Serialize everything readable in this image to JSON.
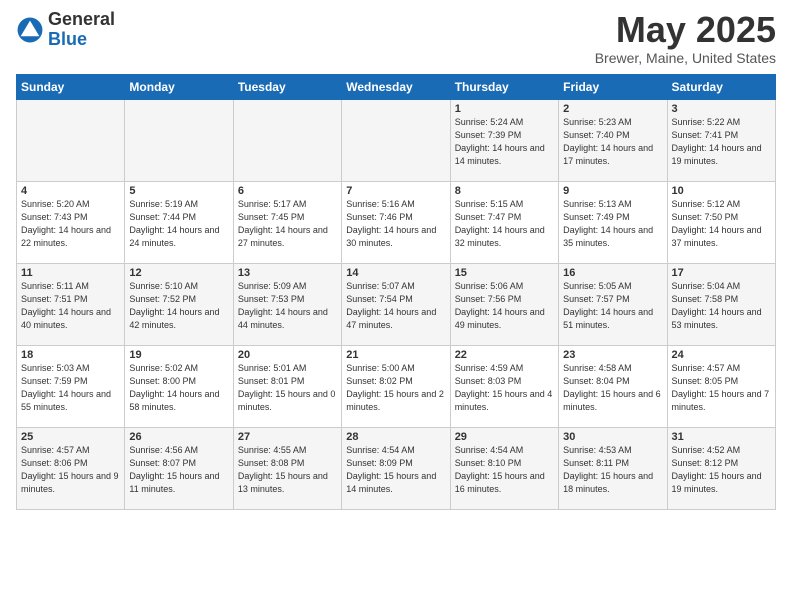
{
  "header": {
    "logo_general": "General",
    "logo_blue": "Blue",
    "title": "May 2025",
    "subtitle": "Brewer, Maine, United States"
  },
  "weekdays": [
    "Sunday",
    "Monday",
    "Tuesday",
    "Wednesday",
    "Thursday",
    "Friday",
    "Saturday"
  ],
  "weeks": [
    [
      {
        "day": null,
        "sunrise": null,
        "sunset": null,
        "daylight": null
      },
      {
        "day": null,
        "sunrise": null,
        "sunset": null,
        "daylight": null
      },
      {
        "day": null,
        "sunrise": null,
        "sunset": null,
        "daylight": null
      },
      {
        "day": null,
        "sunrise": null,
        "sunset": null,
        "daylight": null
      },
      {
        "day": "1",
        "sunrise": "5:24 AM",
        "sunset": "7:39 PM",
        "daylight": "14 hours and 14 minutes."
      },
      {
        "day": "2",
        "sunrise": "5:23 AM",
        "sunset": "7:40 PM",
        "daylight": "14 hours and 17 minutes."
      },
      {
        "day": "3",
        "sunrise": "5:22 AM",
        "sunset": "7:41 PM",
        "daylight": "14 hours and 19 minutes."
      }
    ],
    [
      {
        "day": "4",
        "sunrise": "5:20 AM",
        "sunset": "7:43 PM",
        "daylight": "14 hours and 22 minutes."
      },
      {
        "day": "5",
        "sunrise": "5:19 AM",
        "sunset": "7:44 PM",
        "daylight": "14 hours and 24 minutes."
      },
      {
        "day": "6",
        "sunrise": "5:17 AM",
        "sunset": "7:45 PM",
        "daylight": "14 hours and 27 minutes."
      },
      {
        "day": "7",
        "sunrise": "5:16 AM",
        "sunset": "7:46 PM",
        "daylight": "14 hours and 30 minutes."
      },
      {
        "day": "8",
        "sunrise": "5:15 AM",
        "sunset": "7:47 PM",
        "daylight": "14 hours and 32 minutes."
      },
      {
        "day": "9",
        "sunrise": "5:13 AM",
        "sunset": "7:49 PM",
        "daylight": "14 hours and 35 minutes."
      },
      {
        "day": "10",
        "sunrise": "5:12 AM",
        "sunset": "7:50 PM",
        "daylight": "14 hours and 37 minutes."
      }
    ],
    [
      {
        "day": "11",
        "sunrise": "5:11 AM",
        "sunset": "7:51 PM",
        "daylight": "14 hours and 40 minutes."
      },
      {
        "day": "12",
        "sunrise": "5:10 AM",
        "sunset": "7:52 PM",
        "daylight": "14 hours and 42 minutes."
      },
      {
        "day": "13",
        "sunrise": "5:09 AM",
        "sunset": "7:53 PM",
        "daylight": "14 hours and 44 minutes."
      },
      {
        "day": "14",
        "sunrise": "5:07 AM",
        "sunset": "7:54 PM",
        "daylight": "14 hours and 47 minutes."
      },
      {
        "day": "15",
        "sunrise": "5:06 AM",
        "sunset": "7:56 PM",
        "daylight": "14 hours and 49 minutes."
      },
      {
        "day": "16",
        "sunrise": "5:05 AM",
        "sunset": "7:57 PM",
        "daylight": "14 hours and 51 minutes."
      },
      {
        "day": "17",
        "sunrise": "5:04 AM",
        "sunset": "7:58 PM",
        "daylight": "14 hours and 53 minutes."
      }
    ],
    [
      {
        "day": "18",
        "sunrise": "5:03 AM",
        "sunset": "7:59 PM",
        "daylight": "14 hours and 55 minutes."
      },
      {
        "day": "19",
        "sunrise": "5:02 AM",
        "sunset": "8:00 PM",
        "daylight": "14 hours and 58 minutes."
      },
      {
        "day": "20",
        "sunrise": "5:01 AM",
        "sunset": "8:01 PM",
        "daylight": "15 hours and 0 minutes."
      },
      {
        "day": "21",
        "sunrise": "5:00 AM",
        "sunset": "8:02 PM",
        "daylight": "15 hours and 2 minutes."
      },
      {
        "day": "22",
        "sunrise": "4:59 AM",
        "sunset": "8:03 PM",
        "daylight": "15 hours and 4 minutes."
      },
      {
        "day": "23",
        "sunrise": "4:58 AM",
        "sunset": "8:04 PM",
        "daylight": "15 hours and 6 minutes."
      },
      {
        "day": "24",
        "sunrise": "4:57 AM",
        "sunset": "8:05 PM",
        "daylight": "15 hours and 7 minutes."
      }
    ],
    [
      {
        "day": "25",
        "sunrise": "4:57 AM",
        "sunset": "8:06 PM",
        "daylight": "15 hours and 9 minutes."
      },
      {
        "day": "26",
        "sunrise": "4:56 AM",
        "sunset": "8:07 PM",
        "daylight": "15 hours and 11 minutes."
      },
      {
        "day": "27",
        "sunrise": "4:55 AM",
        "sunset": "8:08 PM",
        "daylight": "15 hours and 13 minutes."
      },
      {
        "day": "28",
        "sunrise": "4:54 AM",
        "sunset": "8:09 PM",
        "daylight": "15 hours and 14 minutes."
      },
      {
        "day": "29",
        "sunrise": "4:54 AM",
        "sunset": "8:10 PM",
        "daylight": "15 hours and 16 minutes."
      },
      {
        "day": "30",
        "sunrise": "4:53 AM",
        "sunset": "8:11 PM",
        "daylight": "15 hours and 18 minutes."
      },
      {
        "day": "31",
        "sunrise": "4:52 AM",
        "sunset": "8:12 PM",
        "daylight": "15 hours and 19 minutes."
      }
    ]
  ]
}
